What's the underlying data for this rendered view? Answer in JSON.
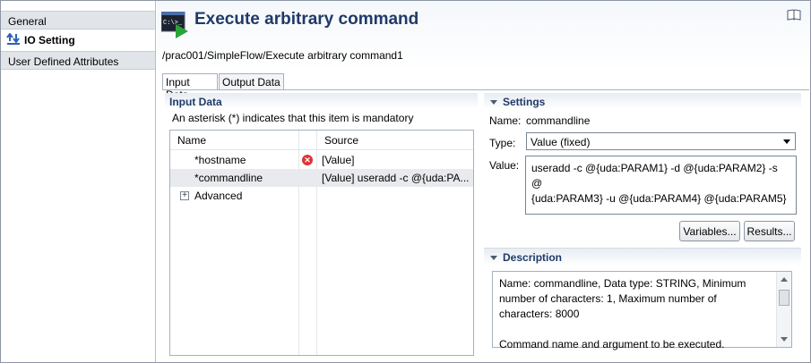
{
  "nav": {
    "general": "General",
    "io_setting": "IO Setting",
    "user_defined_attributes": "User Defined Attributes"
  },
  "header": {
    "title": "Execute arbitrary command",
    "path": "/prac001/SimpleFlow/Execute arbitrary command1",
    "icon_text": "C:\\>_"
  },
  "tabs": {
    "input": "Input Data",
    "output": "Output Data"
  },
  "input_data": {
    "title": "Input Data",
    "mandatory_note": "An asterisk (*) indicates that this item is mandatory",
    "columns": {
      "name": "Name",
      "source": "Source"
    },
    "rows": [
      {
        "name": "*hostname",
        "source": "[Value]",
        "error": true
      },
      {
        "name": "*commandline",
        "source": "[Value] useradd -c @{uda:PA...",
        "selected": true
      },
      {
        "name": "Advanced",
        "expandable": true
      }
    ]
  },
  "settings": {
    "title": "Settings",
    "name_label": "Name:",
    "name_value": "commandline",
    "type_label": "Type:",
    "type_value": "Value (fixed)",
    "value_label": "Value:",
    "value_line1": "useradd -c @{uda:PARAM1} -d @{uda:PARAM2} -s @",
    "value_line2": "{uda:PARAM3} -u @{uda:PARAM4} @{uda:PARAM5}",
    "variables_button": "Variables...",
    "results_button": "Results..."
  },
  "description": {
    "title": "Description",
    "line1": "Name: commandline, Data type: STRING, Minimum",
    "line2": "number of characters: 1, Maximum number of",
    "line3": "characters: 8000",
    "line4": "Command name and argument to be executed."
  },
  "colors": {
    "title_blue": "#1f3a68",
    "error_red": "#e03333",
    "icon_green": "#2aa33a"
  }
}
